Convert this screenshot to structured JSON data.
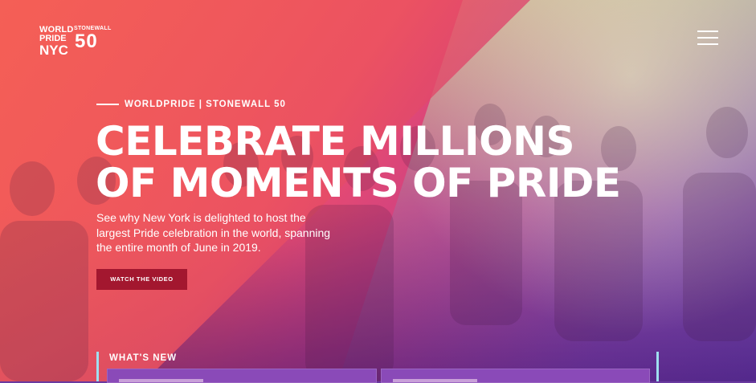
{
  "logo": {
    "line1": "WORLD",
    "line2": "PRIDE",
    "line3": "NYC",
    "partner": "STONEWALL",
    "number": "50"
  },
  "menu_icon": "hamburger-icon",
  "hero": {
    "eyebrow": "WORLDPRIDE | STONEWALL 50",
    "headline_line1": "CELEBRATE MILLIONS",
    "headline_line2": "OF MOMENTS OF PRIDE",
    "lede": "See why New York is delighted to host the largest Pride celebration in the world, spanning the entire month of June in 2019.",
    "cta_label": "WATCH THE VIDEO"
  },
  "whats_new": {
    "label": "WHAT'S NEW"
  },
  "colors": {
    "cta_bg": "#a3172f",
    "accent_bar": "#9fdff0",
    "gradient_start": "#f0605a",
    "gradient_end": "#6b3bb0"
  }
}
